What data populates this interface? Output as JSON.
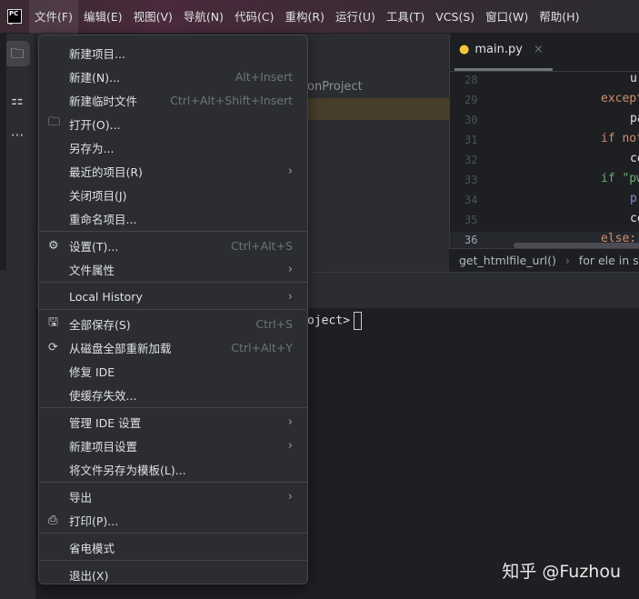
{
  "menubar": {
    "items": [
      "文件(F)",
      "编辑(E)",
      "视图(V)",
      "导航(N)",
      "代码(C)",
      "重构(R)",
      "运行(U)",
      "工具(T)",
      "VCS(S)",
      "窗口(W)",
      "帮助(H)"
    ]
  },
  "project": {
    "title": "onProject"
  },
  "editor": {
    "tab": "main.py",
    "line_numbers": [
      "28",
      "29",
      "30",
      "31",
      "32",
      "33",
      "34",
      "35",
      "36"
    ],
    "code": [
      {
        "t": "ur",
        "c": "#dfe1e5"
      },
      {
        "t": "except",
        "c": "#cf8e6d"
      },
      {
        "t": "pa",
        "c": "#dfe1e5"
      },
      {
        "t": "if not",
        "c": "#cf8e6d"
      },
      {
        "t": "co",
        "c": "#dfe1e5"
      },
      {
        "t": "if \"pw",
        "c": "#6aab73"
      },
      {
        "t": "pr",
        "c": "#8888c6"
      },
      {
        "t": "co",
        "c": "#dfe1e5"
      },
      {
        "t": "else:",
        "c": "#cf8e6d"
      }
    ],
    "breadcrumb": [
      "get_htmlfile_url()",
      "for ele in se"
    ]
  },
  "terminal": {
    "prompt": "oject>"
  },
  "menu": {
    "items": [
      {
        "label": "新建项目...",
        "icon": "",
        "shortcut": ""
      },
      {
        "label": "新建(N)...",
        "icon": "",
        "shortcut": "Alt+Insert"
      },
      {
        "label": "新建临时文件",
        "icon": "",
        "shortcut": "Ctrl+Alt+Shift+Insert"
      },
      {
        "label": "打开(O)...",
        "icon": "folder-icon",
        "shortcut": ""
      },
      {
        "label": "另存为...",
        "icon": "",
        "shortcut": ""
      },
      {
        "label": "最近的项目(R)",
        "icon": "",
        "shortcut": "",
        "submenu": true
      },
      {
        "label": "关闭项目(J)",
        "icon": "",
        "shortcut": ""
      },
      {
        "label": "重命名项目...",
        "icon": "",
        "shortcut": ""
      },
      {
        "sep": true
      },
      {
        "label": "设置(T)...",
        "icon": "gear-icon",
        "shortcut": "Ctrl+Alt+S"
      },
      {
        "label": "文件属性",
        "icon": "",
        "shortcut": "",
        "submenu": true
      },
      {
        "sep": true
      },
      {
        "label": "Local History",
        "icon": "",
        "shortcut": "",
        "submenu": true
      },
      {
        "sep": true
      },
      {
        "label": "全部保存(S)",
        "icon": "save-icon",
        "shortcut": "Ctrl+S"
      },
      {
        "label": "从磁盘全部重新加载",
        "icon": "reload-icon",
        "shortcut": "Ctrl+Alt+Y"
      },
      {
        "label": "修复 IDE",
        "icon": "",
        "shortcut": ""
      },
      {
        "label": "使缓存失效...",
        "icon": "",
        "shortcut": ""
      },
      {
        "sep": true
      },
      {
        "label": "管理 IDE 设置",
        "icon": "",
        "shortcut": "",
        "submenu": true
      },
      {
        "label": "新建项目设置",
        "icon": "",
        "shortcut": "",
        "submenu": true
      },
      {
        "label": "将文件另存为模板(L)...",
        "icon": "",
        "shortcut": ""
      },
      {
        "sep": true
      },
      {
        "label": "导出",
        "icon": "",
        "shortcut": "",
        "submenu": true
      },
      {
        "label": "打印(P)...",
        "icon": "print-icon",
        "shortcut": ""
      },
      {
        "sep": true
      },
      {
        "label": "省电模式",
        "icon": "",
        "shortcut": ""
      },
      {
        "sep": true
      },
      {
        "label": "退出(X)",
        "icon": "",
        "shortcut": ""
      }
    ]
  },
  "watermark": "知乎 @Fuzhou"
}
